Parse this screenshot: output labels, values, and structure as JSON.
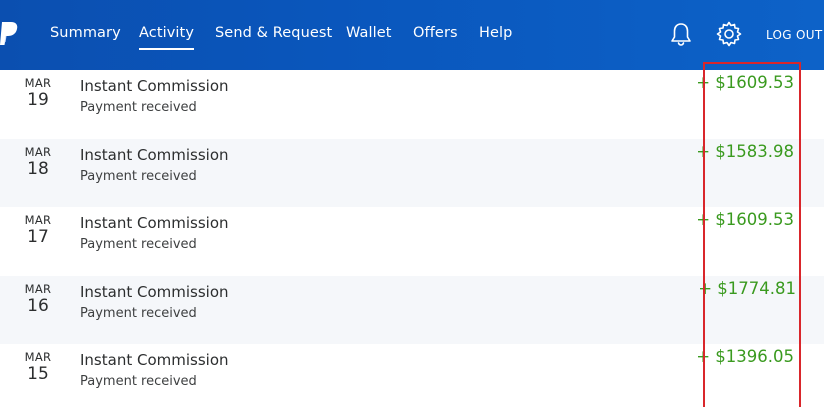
{
  "header": {
    "nav": [
      {
        "label": "Summary"
      },
      {
        "label": "Activity"
      },
      {
        "label": "Send & Request"
      },
      {
        "label": "Wallet"
      },
      {
        "label": "Offers"
      },
      {
        "label": "Help"
      }
    ],
    "active_tab": "Activity",
    "notification_icon": "bell-icon",
    "settings_icon": "gear-icon",
    "logout_label": "LOG OUT",
    "brand_color": "#0a57bd"
  },
  "activity": [
    {
      "month": "MAR",
      "day": "19",
      "title": "Instant Commission",
      "status": "Payment received",
      "amount": "+ $1609.53"
    },
    {
      "month": "MAR",
      "day": "18",
      "title": "Instant Commission",
      "status": "Payment received",
      "amount": "+ $1583.98"
    },
    {
      "month": "MAR",
      "day": "17",
      "title": "Instant Commission",
      "status": "Payment received",
      "amount": "+ $1609.53"
    },
    {
      "month": "MAR",
      "day": "16",
      "title": "Instant Commission",
      "status": "Payment received",
      "amount": "+ $1774.81"
    },
    {
      "month": "MAR",
      "day": "15",
      "title": "Instant Commission",
      "status": "Payment received",
      "amount": "+ $1396.05"
    }
  ],
  "colors": {
    "amount_positive": "#3a9a1f",
    "highlight_box": "#d9262b",
    "alt_row": "#f5f7fa"
  }
}
